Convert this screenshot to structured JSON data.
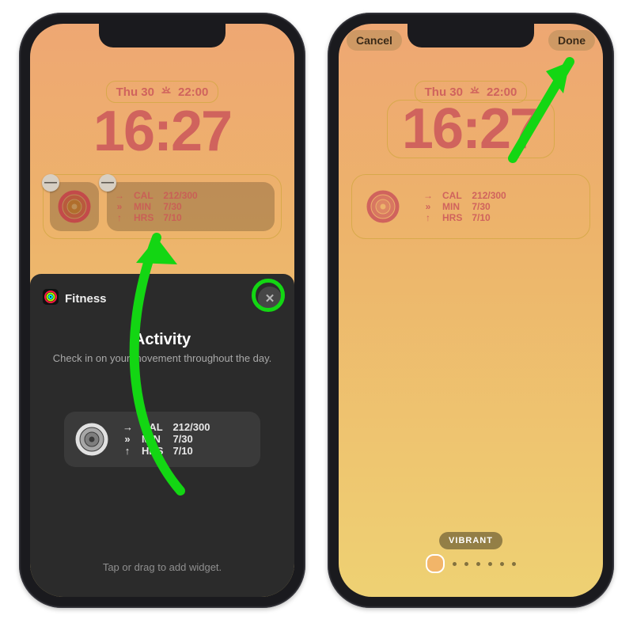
{
  "left": {
    "dateline": {
      "day": "Thu 30",
      "sun_extra": "22:00"
    },
    "clock": "16:27",
    "widget_row": {
      "metrics": [
        {
          "icon": "→",
          "label": "CAL",
          "value": "212/300"
        },
        {
          "icon": "»",
          "label": "MIN",
          "value": "7/30"
        },
        {
          "icon": "↑",
          "label": "HRS",
          "value": "7/10"
        }
      ]
    },
    "sheet": {
      "app_name": "Fitness",
      "section_title": "Activity",
      "section_sub": "Check in on your movement throughout the day.",
      "preview_metrics": [
        {
          "icon": "→",
          "label": "CAL",
          "value": "212/300"
        },
        {
          "icon": "»",
          "label": "MIN",
          "value": "7/30"
        },
        {
          "icon": "↑",
          "label": "HRS",
          "value": "7/10"
        }
      ],
      "hint": "Tap or drag to add widget."
    }
  },
  "right": {
    "nav": {
      "cancel": "Cancel",
      "done": "Done"
    },
    "dateline": {
      "day": "Thu 30",
      "sun_extra": "22:00"
    },
    "clock": "16:27",
    "widget_row": {
      "metrics": [
        {
          "icon": "→",
          "label": "CAL",
          "value": "212/300"
        },
        {
          "icon": "»",
          "label": "MIN",
          "value": "7/30"
        },
        {
          "icon": "↑",
          "label": "HRS",
          "value": "7/10"
        }
      ]
    },
    "vibrant_label": "VIBRANT",
    "page_dots": 6
  },
  "icons": {
    "remove_glyph": "—",
    "close_glyph": "✕"
  }
}
